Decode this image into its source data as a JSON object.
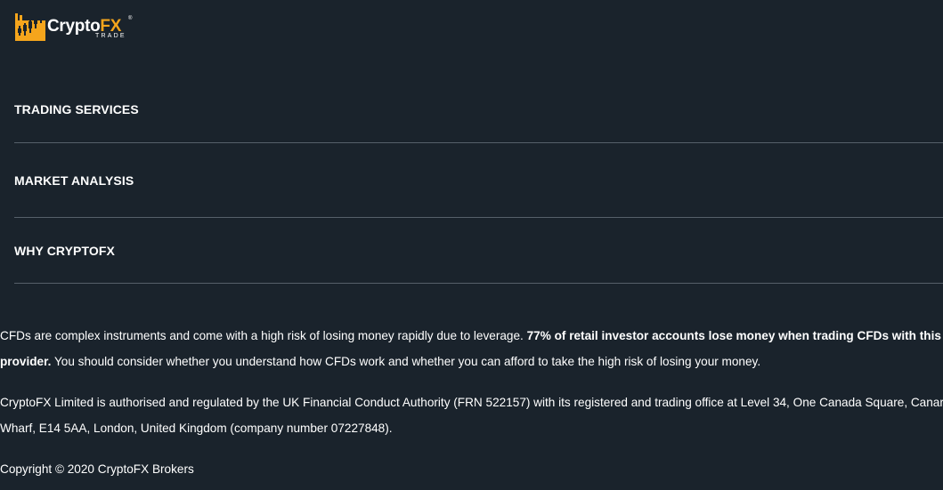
{
  "brand": {
    "name_main": "Crypto",
    "name_accent": "FX",
    "registered_mark": "®",
    "tagline": "TRADE",
    "accent_color": "#f5a51c"
  },
  "nav": {
    "items": [
      {
        "label": "TRADING SERVICES"
      },
      {
        "label": "MARKET ANALYSIS"
      },
      {
        "label": "WHY CRYPTOFX"
      }
    ]
  },
  "footer": {
    "risk_warning": {
      "line1_start": "CFDs are complex instruments and come with a high risk of losing money rapidly due to leverage. ",
      "line1_bold": "77% of retail investor accounts lose money when trading CFDs with this",
      "line2_bold": "provider.",
      "line2_rest": " You should consider whether you understand how CFDs work and whether you can afford to take the high risk of losing your money."
    },
    "regulation": {
      "line1": "CryptoFX Limited is authorised and regulated by the UK Financial Conduct Authority (FRN 522157) with its registered and trading office at Level 34, One Canada Square, Canary",
      "line2": "Wharf, E14 5AA, London, United Kingdom (company number 07227848)."
    },
    "copyright": "Copyright © 2020 CryptoFX Brokers"
  },
  "colors": {
    "background": "#1a232c",
    "divider": "#56606a",
    "text": "#ffffff"
  }
}
